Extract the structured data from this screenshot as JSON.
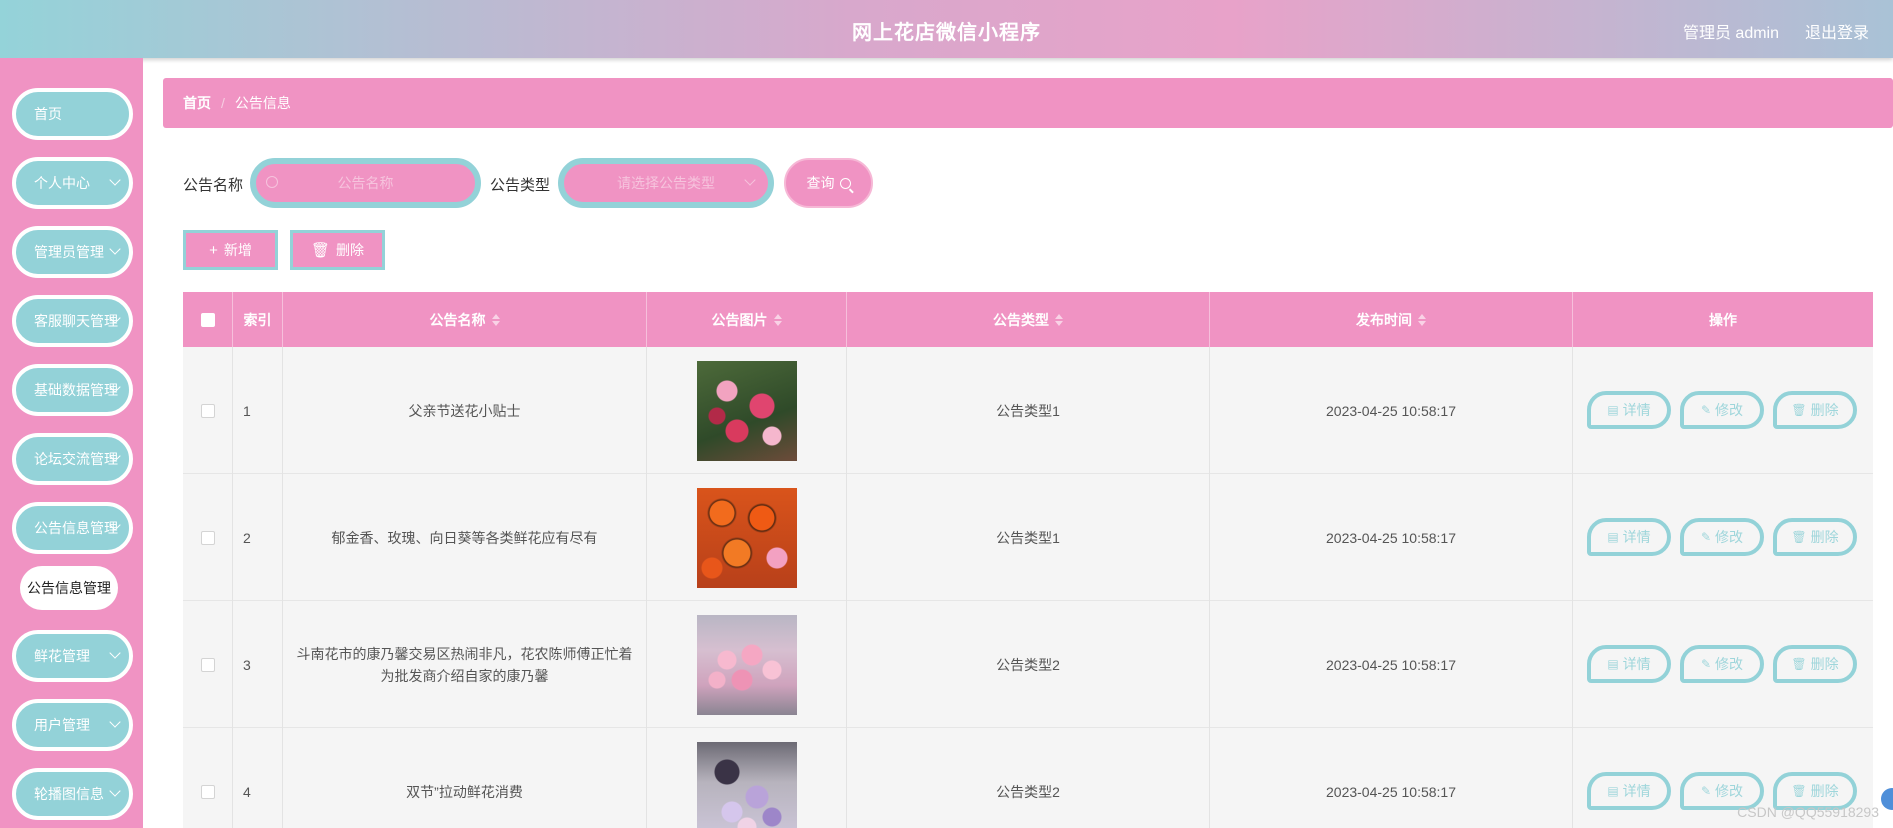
{
  "header": {
    "title": "网上花店微信小程序",
    "user": "管理员 admin",
    "logout": "退出登录"
  },
  "sidebar": {
    "items": [
      {
        "label": "首页",
        "chevron": false
      },
      {
        "label": "个人中心",
        "chevron": true
      },
      {
        "label": "管理员管理",
        "chevron": true
      },
      {
        "label": "客服聊天管理",
        "chevron": true
      },
      {
        "label": "基础数据管理",
        "chevron": true
      },
      {
        "label": "论坛交流管理",
        "chevron": true
      },
      {
        "label": "公告信息管理",
        "chevron": true
      },
      {
        "label": "鲜花管理",
        "chevron": true
      },
      {
        "label": "用户管理",
        "chevron": true
      },
      {
        "label": "轮播图信息",
        "chevron": true
      }
    ],
    "active_submenu": "公告信息管理"
  },
  "breadcrumb": {
    "home": "首页",
    "separator": "/",
    "current": "公告信息"
  },
  "search": {
    "name_label": "公告名称",
    "name_placeholder": "公告名称",
    "type_label": "公告类型",
    "type_placeholder": "请选择公告类型",
    "query_button": "查询"
  },
  "actions": {
    "add_label": "新增",
    "delete_label": "删除"
  },
  "table": {
    "columns": [
      "索引",
      "公告名称",
      "公告图片",
      "公告类型",
      "发布时间",
      "操作"
    ],
    "rows": [
      {
        "index": "1",
        "name": "父亲节送花小贴士",
        "type": "公告类型1",
        "time": "2023-04-25 10:58:17",
        "image": "pink-red-bouquet"
      },
      {
        "index": "2",
        "name": "郁金香、玫瑰、向日葵等各类鲜花应有尽有",
        "type": "公告类型1",
        "time": "2023-04-25 10:58:17",
        "image": "orange-gerbera-bouquet"
      },
      {
        "index": "3",
        "name": "斗南花市的康乃馨交易区热闹非凡，花农陈师傅正忙着为批发商介绍自家的康乃馨",
        "type": "公告类型2",
        "time": "2023-04-25 10:58:17",
        "image": "pink-carnation-bouquet"
      },
      {
        "index": "4",
        "name": "双节”拉动鲜花消费",
        "type": "公告类型2",
        "time": "2023-04-25 10:58:17",
        "image": "purple-bouquet"
      }
    ],
    "ops": {
      "detail": "详情",
      "edit": "修改",
      "delete": "删除"
    }
  },
  "watermark": "CSDN @QQ55918293",
  "colors": {
    "pink": "#f093c3",
    "teal": "#93d2d8",
    "white": "#ffffff"
  }
}
